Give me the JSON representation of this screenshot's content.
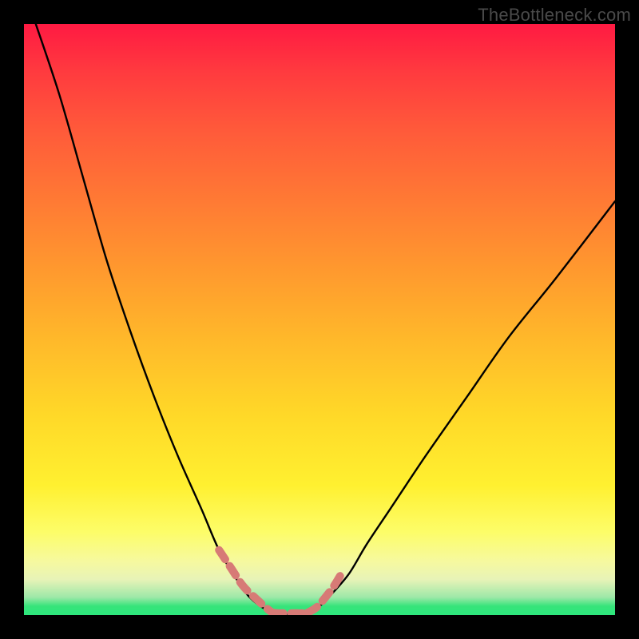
{
  "watermark": "TheBottleneck.com",
  "chart_data": {
    "type": "line",
    "title": "",
    "xlabel": "",
    "ylabel": "",
    "xlim": [
      0,
      100
    ],
    "ylim": [
      0,
      100
    ],
    "series": [
      {
        "name": "left-curve",
        "x": [
          2,
          6,
          10,
          14,
          18,
          22,
          26,
          30,
          33,
          36,
          38,
          40,
          42
        ],
        "values": [
          100,
          88,
          74,
          60,
          48,
          37,
          27,
          18,
          11,
          6,
          3.2,
          1.5,
          0.4
        ]
      },
      {
        "name": "right-curve",
        "x": [
          48,
          50,
          52,
          55,
          58,
          62,
          68,
          75,
          82,
          90,
          100
        ],
        "values": [
          0.4,
          1.5,
          3.5,
          7,
          12,
          18,
          27,
          37,
          47,
          57,
          70
        ]
      },
      {
        "name": "bottom-plateau",
        "x": [
          42,
          43,
          44,
          46,
          48
        ],
        "values": [
          0.4,
          0.2,
          0.2,
          0.2,
          0.4
        ]
      }
    ],
    "marker_points": {
      "comment": "pink dashed segments near valley",
      "left": {
        "x": [
          33,
          35,
          37,
          39,
          41,
          42
        ],
        "values": [
          11,
          8,
          5,
          3,
          1.2,
          0.4
        ]
      },
      "floor": {
        "x": [
          42,
          43,
          44,
          45,
          46,
          47,
          48
        ],
        "values": [
          0.4,
          0.3,
          0.3,
          0.3,
          0.3,
          0.3,
          0.4
        ]
      },
      "right": {
        "x": [
          48,
          49.5,
          51,
          52.5,
          54
        ],
        "values": [
          0.4,
          1.3,
          3,
          5,
          7.5
        ]
      }
    },
    "gradient_stops": [
      {
        "pct": 0,
        "color": "#ff1a42"
      },
      {
        "pct": 30,
        "color": "#ff7a34"
      },
      {
        "pct": 66,
        "color": "#ffd828"
      },
      {
        "pct": 86,
        "color": "#fdfd69"
      },
      {
        "pct": 98,
        "color": "#36e47a"
      },
      {
        "pct": 100,
        "color": "#2ee77d"
      }
    ]
  }
}
